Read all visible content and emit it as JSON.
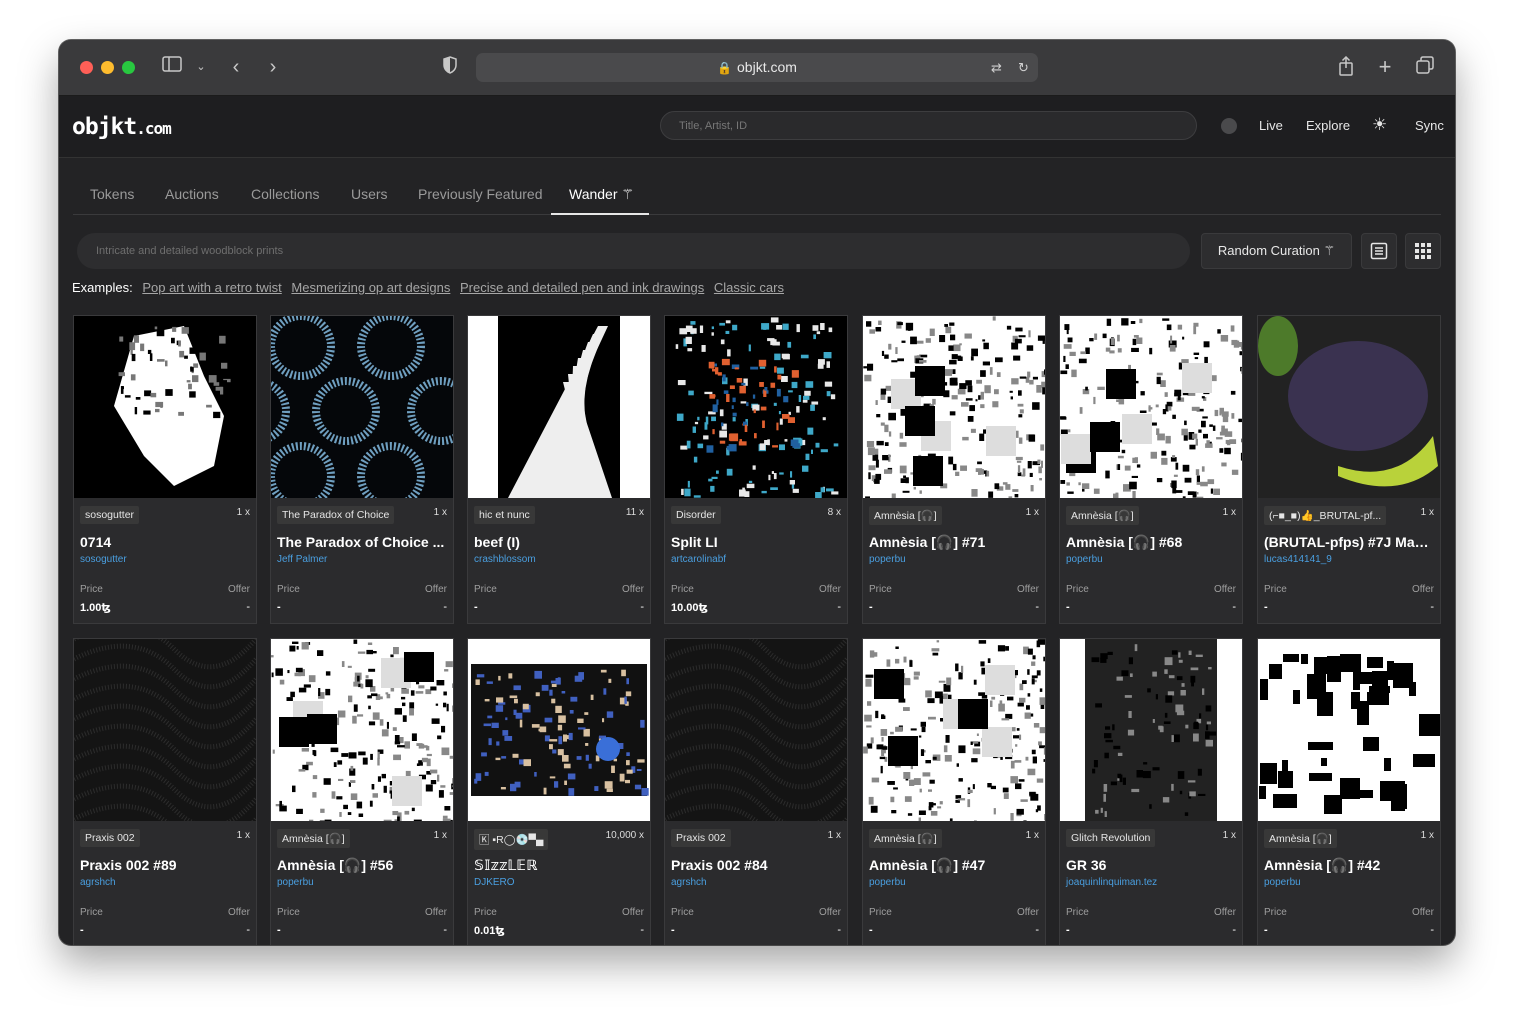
{
  "browser": {
    "url": "objkt.com",
    "icons": [
      "sidebar-icon",
      "chevron-down-icon",
      "back-icon",
      "forward-icon",
      "shield-icon",
      "translate-icon",
      "reload-icon",
      "share-icon",
      "new-tab-icon",
      "tabs-icon"
    ]
  },
  "header": {
    "logo_main": "objkt",
    "logo_suffix": ".com",
    "search_placeholder": "Title, Artist, ID",
    "nav": {
      "live": "Live",
      "explore": "Explore",
      "sync": "Sync"
    }
  },
  "tabs": [
    "Tokens",
    "Auctions",
    "Collections",
    "Users",
    "Previously Featured",
    "Wander"
  ],
  "active_tab": "Wander",
  "wander": {
    "placeholder": "Intricate and detailed woodblock prints",
    "random_button": "Random Curation",
    "examples_label": "Examples:",
    "examples": [
      "Pop art with a retro twist",
      "Mesmerizing op art designs",
      "Precise and detailed pen and ink drawings",
      "Classic cars"
    ]
  },
  "card_labels": {
    "price": "Price",
    "offer": "Offer"
  },
  "cards": [
    {
      "collection": "sosogutter",
      "editions": "1 x",
      "title": "0714",
      "artist": "sosogutter",
      "price": "1.00ꜩ",
      "offer": "-"
    },
    {
      "collection": "The Paradox of Choice",
      "editions": "1 x",
      "title": "The Paradox of Choice ...",
      "artist": "Jeff Palmer",
      "price": "-",
      "offer": "-"
    },
    {
      "collection": "hic et nunc",
      "editions": "11 x",
      "title": "beef (I)",
      "artist": "crashblossom",
      "price": "-",
      "offer": "-"
    },
    {
      "collection": "Disorder",
      "editions": "8 x",
      "title": "Split LI",
      "artist": "artcarolinabf",
      "price": "10.00ꜩ",
      "offer": "-"
    },
    {
      "collection": "Amnèsia [🎧]",
      "editions": "1 x",
      "title": "Amnèsia [🎧] #71",
      "artist": "poperbu",
      "price": "-",
      "offer": "-"
    },
    {
      "collection": "Amnèsia [🎧]",
      "editions": "1 x",
      "title": "Amnèsia [🎧] #68",
      "artist": "poperbu",
      "price": "-",
      "offer": "-"
    },
    {
      "collection": "(⌐■_■)👍_BRUTAL-pf...",
      "editions": "1 x",
      "title": "(BRUTAL-pfps) #7J Mad...",
      "artist": "lucas414141_9",
      "price": "-",
      "offer": "-"
    },
    {
      "collection": "Praxis 002",
      "editions": "1 x",
      "title": "Praxis 002 #89",
      "artist": "agrshch",
      "price": "-",
      "offer": "-"
    },
    {
      "collection": "Amnèsia [🎧]",
      "editions": "1 x",
      "title": "Amnèsia [🎧] #56",
      "artist": "poperbu",
      "price": "-",
      "offer": "-"
    },
    {
      "collection": "🄺 ▪R◯💿▀▄",
      "editions": "10,000 x",
      "title": "𝕊𝕀𝕫𝕫𝕃𝔼ℝ",
      "artist": "DJKERO",
      "price": "0.01ꜩ",
      "offer": "-"
    },
    {
      "collection": "Praxis 002",
      "editions": "1 x",
      "title": "Praxis 002 #84",
      "artist": "agrshch",
      "price": "-",
      "offer": "-"
    },
    {
      "collection": "Amnèsia [🎧]",
      "editions": "1 x",
      "title": "Amnèsia [🎧] #47",
      "artist": "poperbu",
      "price": "-",
      "offer": "-"
    },
    {
      "collection": "Glitch Revolution",
      "editions": "1 x",
      "title": "GR 36",
      "artist": "joaquinlinquiman.tez",
      "price": "-",
      "offer": "-"
    },
    {
      "collection": "Amnèsia [🎧]",
      "editions": "1 x",
      "title": "Amnèsia [🎧] #42",
      "artist": "poperbu",
      "price": "-",
      "offer": "-"
    }
  ]
}
